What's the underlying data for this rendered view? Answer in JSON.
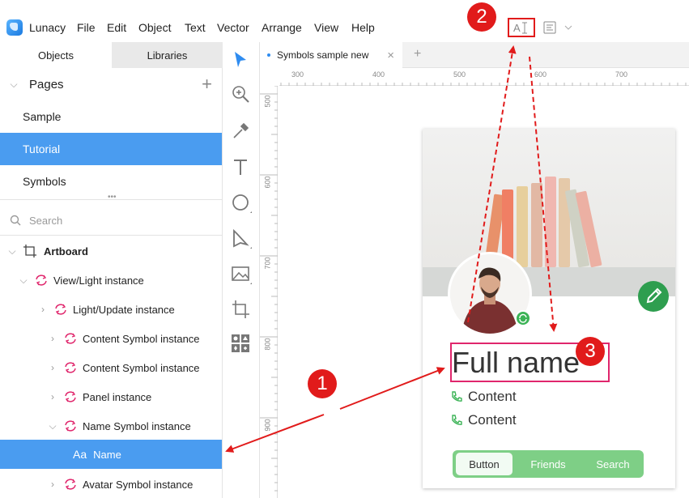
{
  "app": {
    "name": "Lunacy"
  },
  "menu": [
    "File",
    "Edit",
    "Object",
    "Text",
    "Vector",
    "Arrange",
    "View",
    "Help"
  ],
  "panel_tabs": {
    "objects": "Objects",
    "libraries": "Libraries"
  },
  "pages": {
    "header": "Pages",
    "items": [
      {
        "label": "Sample",
        "selected": false
      },
      {
        "label": "Tutorial",
        "selected": true
      },
      {
        "label": "Symbols",
        "selected": false
      }
    ]
  },
  "search": {
    "placeholder": "Search"
  },
  "layers": {
    "artboard": "Artboard",
    "view": "View/Light instance",
    "light_update": "Light/Update instance",
    "content1": "Content Symbol instance",
    "content2": "Content Symbol instance",
    "panel": "Panel instance",
    "name_symbol": "Name Symbol instance",
    "name": "Name",
    "name_glyph": "Aa",
    "avatar": "Avatar Symbol instance"
  },
  "doc_tab": {
    "label": "Symbols sample new"
  },
  "ruler": {
    "h": [
      "300",
      "400",
      "500",
      "600",
      "700"
    ],
    "v": [
      "500",
      "600",
      "700",
      "800",
      "900"
    ]
  },
  "card": {
    "name": "Full name",
    "content1": "Content",
    "content2": "Content",
    "buttons": [
      "Button",
      "Friends",
      "Search"
    ]
  },
  "annotations": [
    "1",
    "2",
    "3"
  ],
  "colors": {
    "selection": "#4a9cf0",
    "accent_green": "#7ecf86",
    "fab": "#2e9e4f",
    "annotation": "#e11b1b",
    "text_box": "#e0266c"
  }
}
